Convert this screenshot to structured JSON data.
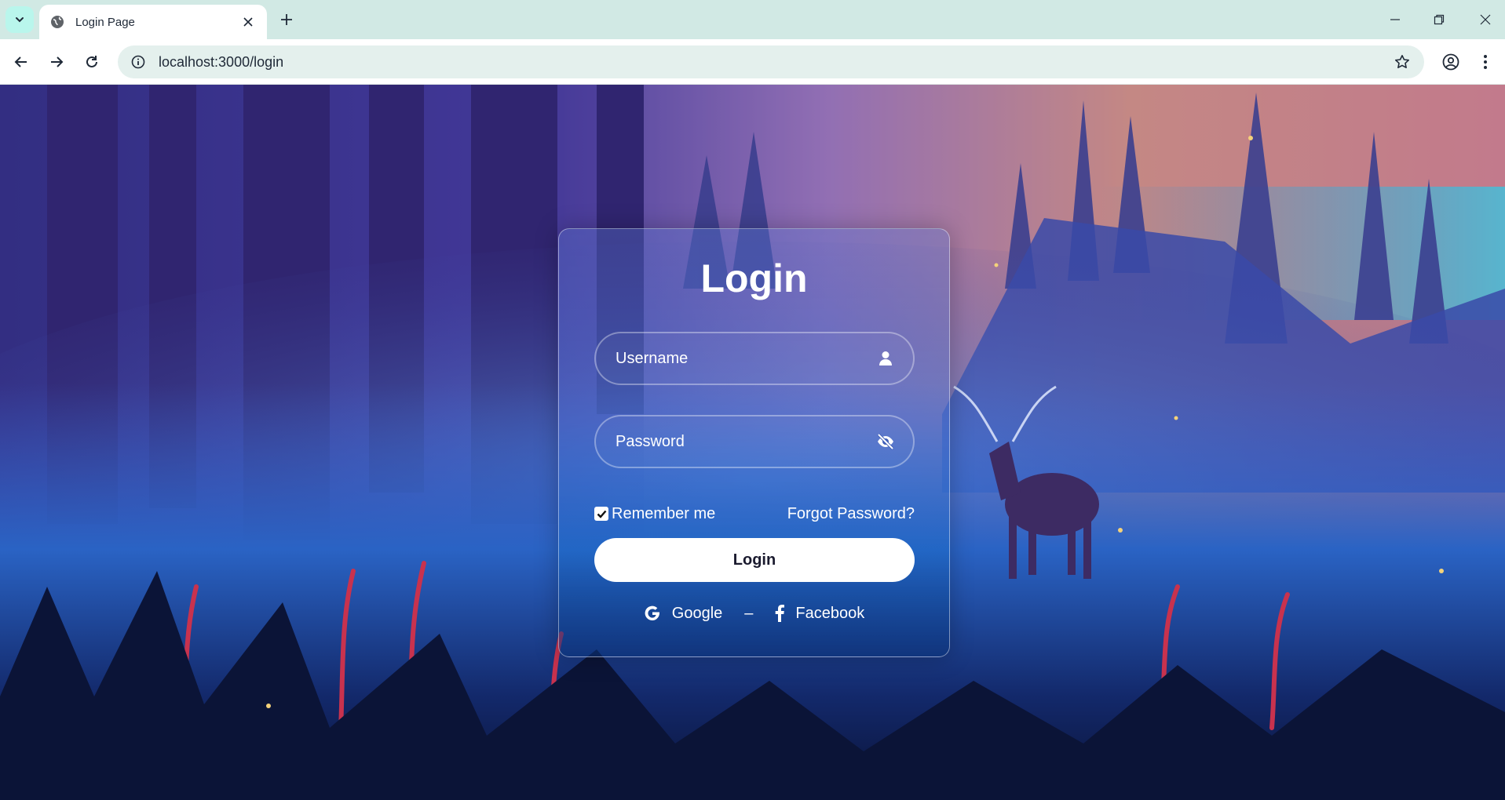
{
  "browser": {
    "tab_title": "Login Page",
    "url": "localhost:3000/login",
    "icons": [
      "tab-list-icon",
      "globe-icon",
      "close-icon",
      "plus-icon",
      "minimize-icon",
      "restore-icon",
      "close-icon",
      "back-arrow-icon",
      "forward-arrow-icon",
      "reload-icon",
      "info-icon",
      "star-icon",
      "profile-icon",
      "kebab-menu-icon"
    ]
  },
  "login": {
    "title": "Login",
    "username_placeholder": "Username",
    "password_placeholder": "Password",
    "remember_label": "Remember me",
    "remember_checked": true,
    "forgot_label": "Forgot Password?",
    "submit_label": "Login",
    "google_label": "Google",
    "separator": "–",
    "facebook_label": "Facebook"
  },
  "colors": {
    "chrome_bg": "#d1e9e4",
    "omnibox_bg": "#e4f0ed",
    "button_bg": "#ffffff",
    "button_text": "#1a1a2e"
  }
}
